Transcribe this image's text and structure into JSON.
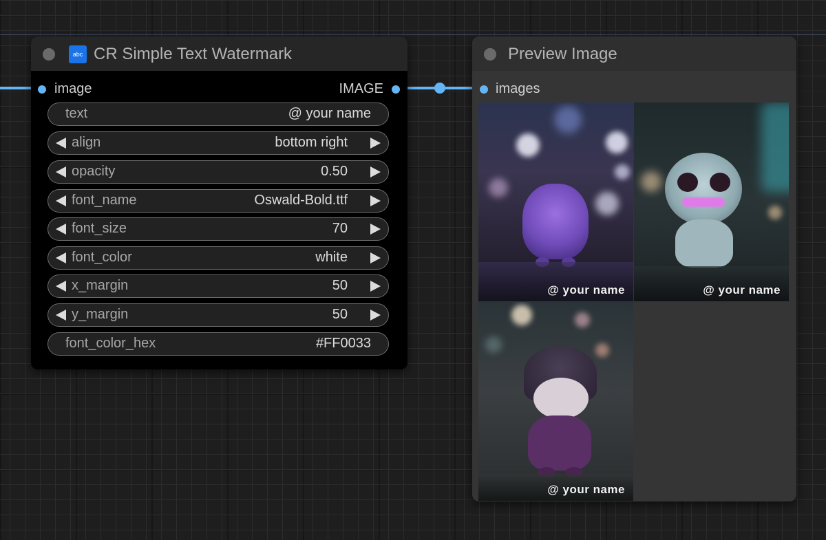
{
  "watermark_node": {
    "title": "CR Simple Text Watermark",
    "icon_text": "abc",
    "input_label": "image",
    "output_label": "IMAGE",
    "widgets": [
      {
        "label": "text",
        "value": "@ your name",
        "has_arrows": false
      },
      {
        "label": "align",
        "value": "bottom right",
        "has_arrows": true
      },
      {
        "label": "opacity",
        "value": "0.50",
        "has_arrows": true
      },
      {
        "label": "font_name",
        "value": "Oswald-Bold.ttf",
        "has_arrows": true
      },
      {
        "label": "font_size",
        "value": "70",
        "has_arrows": true
      },
      {
        "label": "font_color",
        "value": "white",
        "has_arrows": true
      },
      {
        "label": "x_margin",
        "value": "50",
        "has_arrows": true
      },
      {
        "label": "y_margin",
        "value": "50",
        "has_arrows": true
      },
      {
        "label": "font_color_hex",
        "value": "#FF0033",
        "has_arrows": false
      }
    ]
  },
  "preview_node": {
    "title": "Preview Image",
    "input_label": "images",
    "watermarks": [
      "@ your name",
      "@ your name",
      "@ your name"
    ]
  },
  "colors": {
    "canvas": "#1e1e1e",
    "link": "#64b5f6",
    "node_body_watermark": "#000000",
    "node_body_preview": "#353535"
  }
}
